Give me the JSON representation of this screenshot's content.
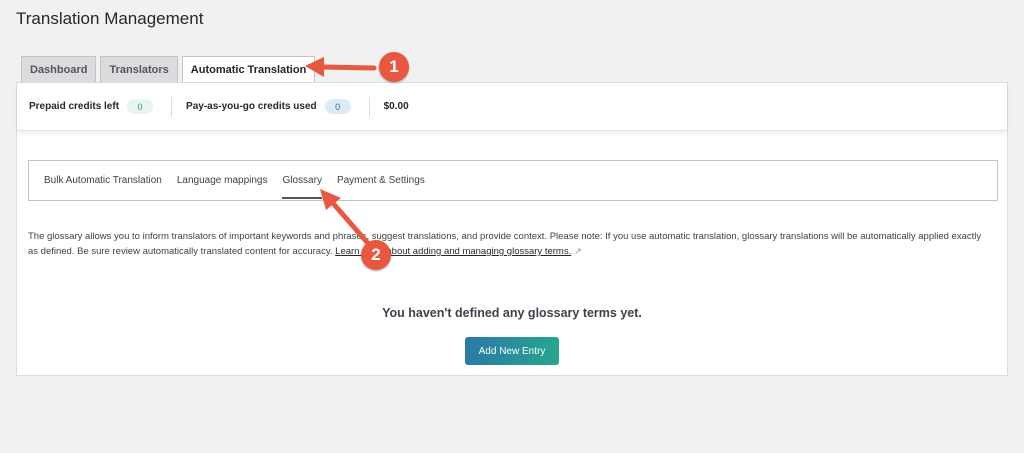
{
  "page": {
    "title": "Translation Management"
  },
  "top_tabs": [
    {
      "label": "Dashboard",
      "active": false
    },
    {
      "label": "Translators",
      "active": false
    },
    {
      "label": "Automatic Translation",
      "active": true
    }
  ],
  "credits": {
    "prepaid_label": "Prepaid credits left",
    "prepaid_value": "0",
    "payg_label": "Pay-as-you-go credits used",
    "payg_value": "0",
    "amount": "$0.00"
  },
  "sub_tabs": [
    {
      "label": "Bulk Automatic Translation",
      "active": false
    },
    {
      "label": "Language mappings",
      "active": false
    },
    {
      "label": "Glossary",
      "active": true
    },
    {
      "label": "Payment & Settings",
      "active": false
    }
  ],
  "glossary": {
    "description": "The glossary allows you to inform translators of important keywords and phrases, suggest translations, and provide context. Please note: If you use automatic translation, glossary translations will be automatically applied exactly as defined. Be sure review automatically translated content for accuracy.",
    "learn_more_link": "Learn more about adding and managing glossary terms.",
    "empty_message": "You haven't defined any glossary terms yet.",
    "add_button_label": "Add New Entry"
  },
  "annotations": [
    {
      "label": "1"
    },
    {
      "label": "2"
    }
  ],
  "colors": {
    "callout": "#e8573f",
    "button_gradient_start": "#2a7aa6",
    "button_gradient_end": "#27a58e"
  }
}
